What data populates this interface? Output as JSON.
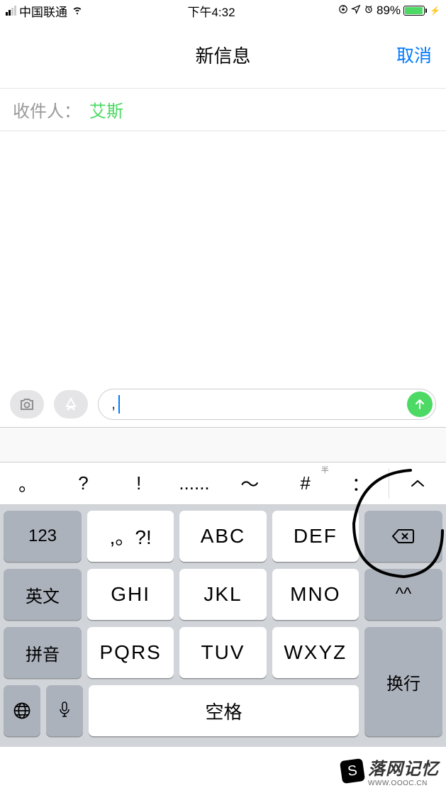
{
  "status": {
    "carrier": "中国联通",
    "time": "下午4:32",
    "battery_pct": "89%"
  },
  "nav": {
    "title": "新信息",
    "cancel": "取消"
  },
  "recipient": {
    "label": "收件人：",
    "name": "艾斯"
  },
  "input": {
    "value": ","
  },
  "punct_keys": [
    "。",
    "?",
    "!",
    "......",
    "～",
    "#",
    "："
  ],
  "punct_sup": "半",
  "keyboard": {
    "row1": {
      "side": "123",
      "k1": ",。?!",
      "k2": "ABC",
      "k3": "DEF",
      "right": "delete"
    },
    "row2": {
      "side": "英文",
      "k1": "GHI",
      "k2": "JKL",
      "k3": "MNO",
      "right": "^^"
    },
    "row3": {
      "side": "拼音",
      "k1": "PQRS",
      "k2": "TUV",
      "k3": "WXYZ",
      "right": "换行"
    },
    "row4": {
      "globe": "globe",
      "mic": "mic",
      "space": "空格",
      "right_cont": "换行"
    }
  },
  "watermark": {
    "main": "落网记忆",
    "sub": "WWW.OOOC.CN"
  }
}
